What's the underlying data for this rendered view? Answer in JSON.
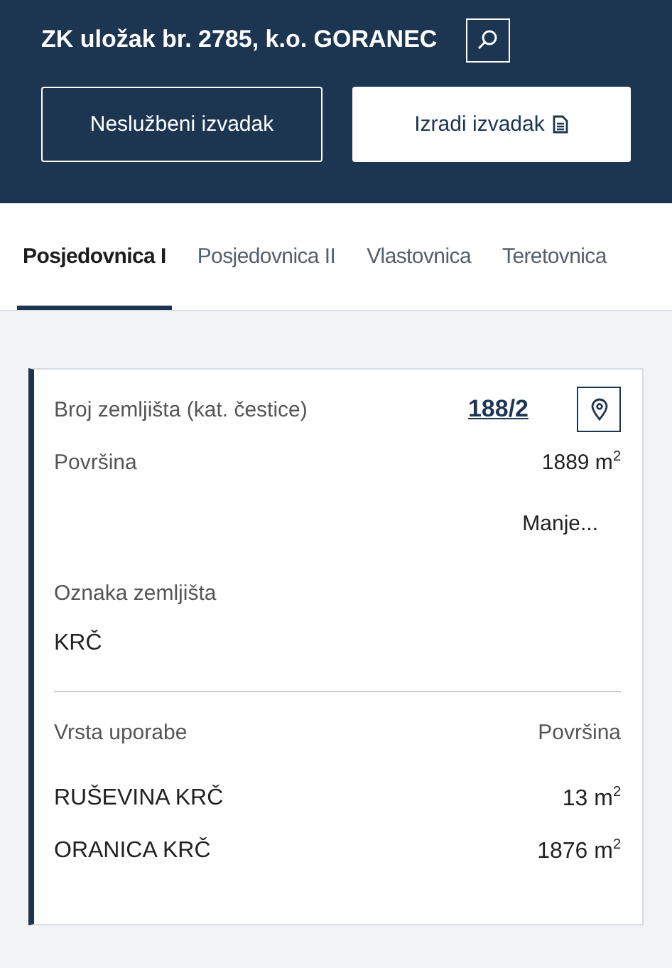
{
  "header": {
    "title": "ZK uložak br. 2785, k.o. GORANEC",
    "buttons": [
      {
        "label": "Neslužbeni izvadak",
        "kind": "outline"
      },
      {
        "label": "Izradi izvadak",
        "kind": "filled"
      }
    ]
  },
  "tabs": [
    {
      "label": "Posjedovnica I",
      "selected": true
    },
    {
      "label": "Posjedovnica II",
      "selected": false
    },
    {
      "label": "Vlastovnica",
      "selected": false
    },
    {
      "label": "Teretovnica",
      "selected": false
    }
  ],
  "parcel": {
    "number_label": "Broj zemljišta (kat. čestice)",
    "number": "188/2",
    "area_label": "Površina",
    "area": "1889 m$^{2}$",
    "toggle": "Manje...",
    "mark_label": "Oznaka zemljišta",
    "mark": "KRČ",
    "usage_header": [
      "Vrsta uporabe",
      "Površina"
    ],
    "usages": [
      {
        "name": "RUŠEVINA KRČ",
        "area": "13 m$^{2}$"
      },
      {
        "name": "ORANICA KRČ",
        "area": "1876 m$^{2}$"
      }
    ]
  }
}
